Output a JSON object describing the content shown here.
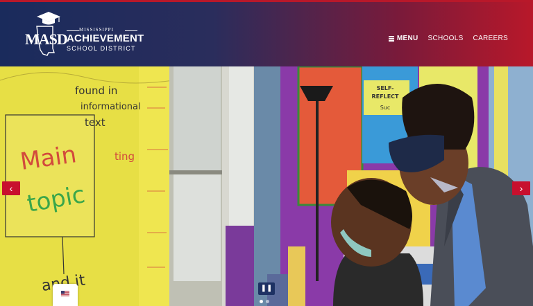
{
  "brand": {
    "mark": "MASD",
    "state_line": "MISSISSIPPI",
    "name_line": "ACHIEVEMENT",
    "sub_line": "SCHOOL DISTRICT"
  },
  "nav": {
    "menu_label": "MENU",
    "schools_label": "SCHOOLS",
    "careers_label": "CAREERS"
  },
  "hero": {
    "poster_main": "Main",
    "poster_topic": "topic",
    "note_lines": [
      "found in",
      "informational",
      "text"
    ],
    "side_words": [
      "ting"
    ],
    "board_letters": "SELF-",
    "board_line2": "REFLECT",
    "board_line3": "Suc",
    "bottom_text": "and it",
    "prev_arrow": "‹",
    "next_arrow": "›",
    "pause_label": "❚❚"
  },
  "language_selector": {
    "flag": "us-flag-icon"
  },
  "colors": {
    "header_left": "#1a2b5c",
    "header_right": "#b8182a",
    "accent_red": "#c8102e",
    "pause_bg": "#1e3264"
  }
}
